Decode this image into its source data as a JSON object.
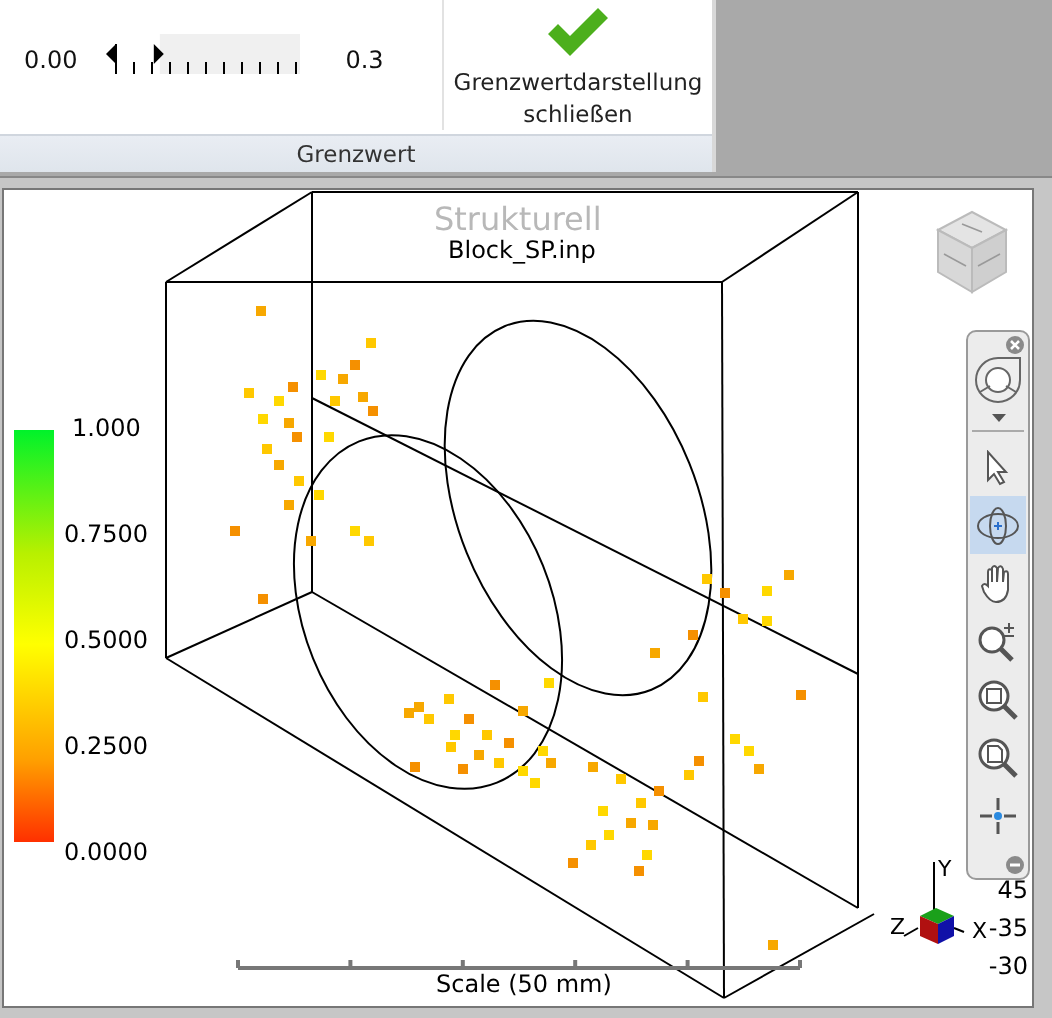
{
  "ribbon": {
    "slider": {
      "min_label": "0.00",
      "max_label": "0.3",
      "level": 0.27
    },
    "button": {
      "label": "Grenzwertdarstellung schließen"
    },
    "group_label": "Grenzwert"
  },
  "viewport": {
    "title": "Strukturell",
    "file_name": "Block_SP.inp",
    "legend": {
      "labels": [
        "1.000",
        "0.7500",
        "0.5000",
        "0.2500",
        "0.0000"
      ]
    },
    "scale_label": "Scale (50 mm)",
    "axes": {
      "y": "Y",
      "x": "X",
      "z": "Z"
    },
    "readings": [
      "45",
      "-35",
      "-30"
    ],
    "nav_tools": [
      {
        "kind": "wheel",
        "selected": false
      },
      {
        "kind": "select",
        "selected": false
      },
      {
        "kind": "orbit",
        "selected": true
      },
      {
        "kind": "pan",
        "selected": false
      },
      {
        "kind": "zoom",
        "selected": false
      },
      {
        "kind": "zoom-window",
        "selected": false
      },
      {
        "kind": "zoom-extents",
        "selected": false
      },
      {
        "kind": "center",
        "selected": false
      }
    ]
  }
}
